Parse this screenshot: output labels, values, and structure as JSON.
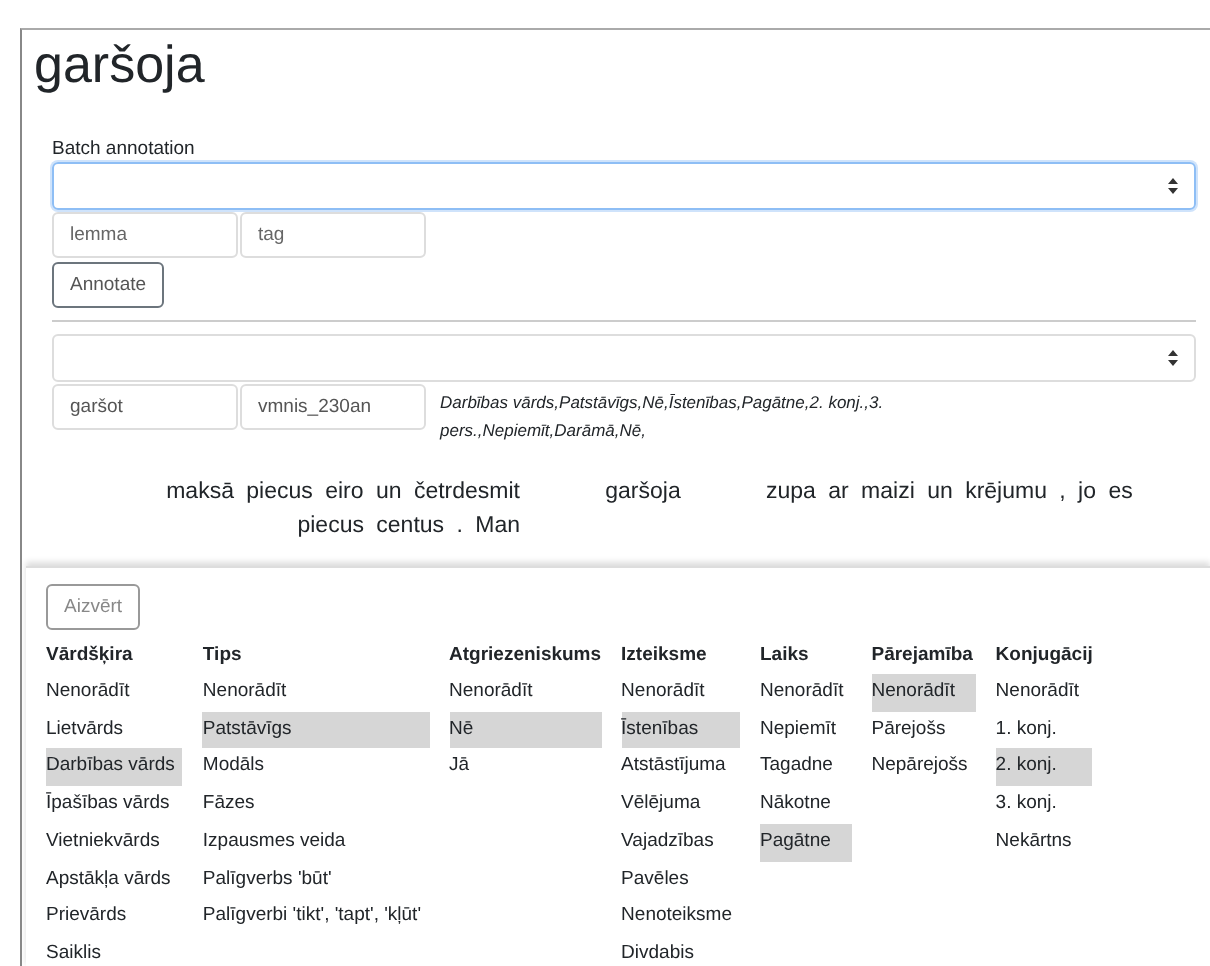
{
  "heading": "garšoja",
  "batch": {
    "label": "Batch annotation",
    "lemma_placeholder": "lemma",
    "tag_placeholder": "tag",
    "button": "Annotate"
  },
  "annotation": {
    "lemma": "garšot",
    "tag": "vmnis_230an",
    "description": "Darbības vārds,Patstāvīgs,Nē,Īstenības,Pagātne,2. konj.,3. pers.,Nepiemīt,Darāmā,Nē,"
  },
  "context": {
    "left": "maksā piecus eiro un četrdesmit piecus centus . Man",
    "word": "garšoja",
    "right": "zupa ar maizi un krējumu , jo es"
  },
  "panel": {
    "close_button": "Aizvērt",
    "columns": [
      {
        "title": "Vārdšķira",
        "items": [
          {
            "label": "Nenorādīt",
            "selected": false
          },
          {
            "label": "Lietvārds",
            "selected": false
          },
          {
            "label": "Darbības vārds",
            "selected": true
          },
          {
            "label": "Īpašības vārds",
            "selected": false
          },
          {
            "label": "Vietniekvārds",
            "selected": false
          },
          {
            "label": "Apstākļa vārds",
            "selected": false
          },
          {
            "label": "Prievārds",
            "selected": false
          },
          {
            "label": "Saiklis",
            "selected": false
          }
        ]
      },
      {
        "title": "Tips",
        "items": [
          {
            "label": "Nenorādīt",
            "selected": false
          },
          {
            "label": "Patstāvīgs",
            "selected": true
          },
          {
            "label": "Modāls",
            "selected": false
          },
          {
            "label": "Fāzes",
            "selected": false
          },
          {
            "label": "Izpausmes veida",
            "selected": false
          },
          {
            "label": "Palīgverbs 'būt'",
            "selected": false
          },
          {
            "label": "Palīgverbi 'tikt', 'tapt', 'kļūt'",
            "selected": false
          }
        ]
      },
      {
        "title": "Atgriezeniskums",
        "items": [
          {
            "label": "Nenorādīt",
            "selected": false
          },
          {
            "label": "Nē",
            "selected": true
          },
          {
            "label": "Jā",
            "selected": false
          }
        ]
      },
      {
        "title": "Izteiksme",
        "items": [
          {
            "label": "Nenorādīt",
            "selected": false
          },
          {
            "label": "Īstenības",
            "selected": true
          },
          {
            "label": "Atstāstījuma",
            "selected": false
          },
          {
            "label": "Vēlējuma",
            "selected": false
          },
          {
            "label": "Vajadzības",
            "selected": false
          },
          {
            "label": "Pavēles",
            "selected": false
          },
          {
            "label": "Nenoteiksme",
            "selected": false
          },
          {
            "label": "Divdabis",
            "selected": false
          }
        ]
      },
      {
        "title": "Laiks",
        "items": [
          {
            "label": "Nenorādīt",
            "selected": false
          },
          {
            "label": "Nepiemīt",
            "selected": false
          },
          {
            "label": "Tagadne",
            "selected": false
          },
          {
            "label": "Nākotne",
            "selected": false
          },
          {
            "label": "Pagātne",
            "selected": true
          }
        ]
      },
      {
        "title": "Pārejamība",
        "items": [
          {
            "label": "Nenorādīt",
            "selected": true
          },
          {
            "label": "Pārejošs",
            "selected": false
          },
          {
            "label": "Nepārejošs",
            "selected": false
          }
        ]
      },
      {
        "title": "Konjugācij",
        "items": [
          {
            "label": "Nenorādīt",
            "selected": false
          },
          {
            "label": "1. konj.",
            "selected": false
          },
          {
            "label": "2. konj.",
            "selected": true
          },
          {
            "label": "3. konj.",
            "selected": false
          },
          {
            "label": "Nekārtns",
            "selected": false
          }
        ]
      }
    ]
  }
}
